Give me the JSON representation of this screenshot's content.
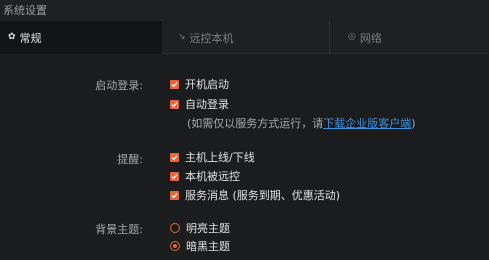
{
  "window": {
    "title": "系统设置"
  },
  "tabs": [
    {
      "label": "常规",
      "icon": "gear-icon",
      "active": true
    },
    {
      "label": "远控本机",
      "icon": "remote-icon",
      "active": false
    },
    {
      "label": "网络",
      "icon": "network-icon",
      "active": false
    }
  ],
  "startup": {
    "label": "启动登录:",
    "options": [
      {
        "label": "开机启动",
        "checked": true
      },
      {
        "label": "自动登录",
        "checked": true
      }
    ],
    "hint_prefix": "(如需仅以服务方式运行，请",
    "hint_link": "下载企业版客户端",
    "hint_suffix": ")"
  },
  "reminders": {
    "label": "提醒:",
    "options": [
      {
        "label": "主机上线/下线",
        "checked": true
      },
      {
        "label": "本机被远控",
        "checked": true
      },
      {
        "label": "服务消息 (服务到期、优惠活动)",
        "checked": true
      }
    ]
  },
  "theme": {
    "label": "背景主题:",
    "options": [
      {
        "label": "明亮主题",
        "selected": false
      },
      {
        "label": "暗黑主题",
        "selected": true
      }
    ]
  },
  "colors": {
    "accent": "#e8643a",
    "link": "#3d8fe0",
    "background": "#1b1c1e"
  }
}
